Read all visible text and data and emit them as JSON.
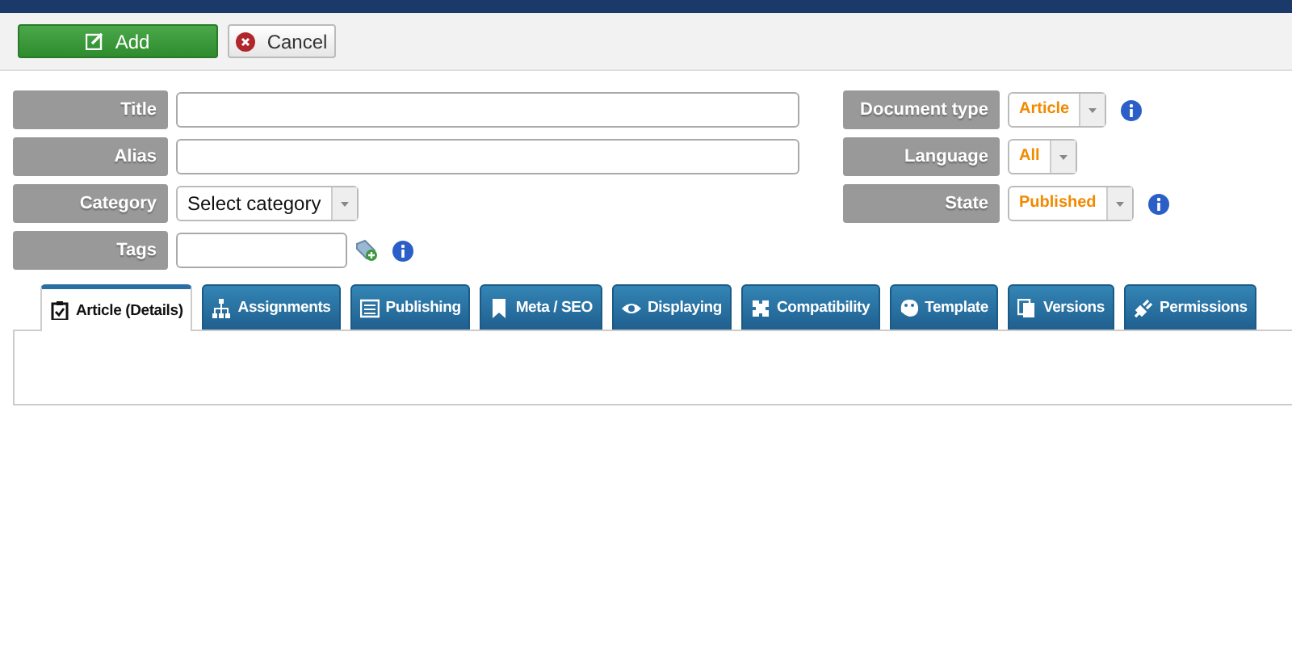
{
  "toolbar": {
    "buttons": [
      {
        "kind": "add",
        "label": "Add"
      },
      {
        "kind": "cancel",
        "label": "Cancel"
      }
    ]
  },
  "form": {
    "left": [
      {
        "label": "Title",
        "kind": "text"
      },
      {
        "label": "Alias",
        "kind": "text"
      },
      {
        "label": "Category",
        "kind": "select",
        "value": "Select category"
      },
      {
        "label": "Tags",
        "kind": "tags",
        "info": true
      }
    ],
    "right": [
      {
        "label": "Document type",
        "kind": "select",
        "value": "Article",
        "info": true
      },
      {
        "label": "Language",
        "kind": "select",
        "value": "All"
      },
      {
        "label": "State",
        "kind": "select",
        "value": "Published",
        "info": true
      }
    ]
  },
  "tabs": [
    {
      "label": "Article (Details)",
      "selected": true
    },
    {
      "label": "Assignments",
      "selected": false
    },
    {
      "label": "Publishing",
      "selected": false
    },
    {
      "label": "Meta / SEO",
      "selected": false
    },
    {
      "label": "Displaying",
      "selected": false
    },
    {
      "label": "Compatibility",
      "selected": false
    },
    {
      "label": "Template",
      "selected": false
    },
    {
      "label": "Versions",
      "selected": false
    },
    {
      "label": "Permissions",
      "selected": false
    }
  ]
}
